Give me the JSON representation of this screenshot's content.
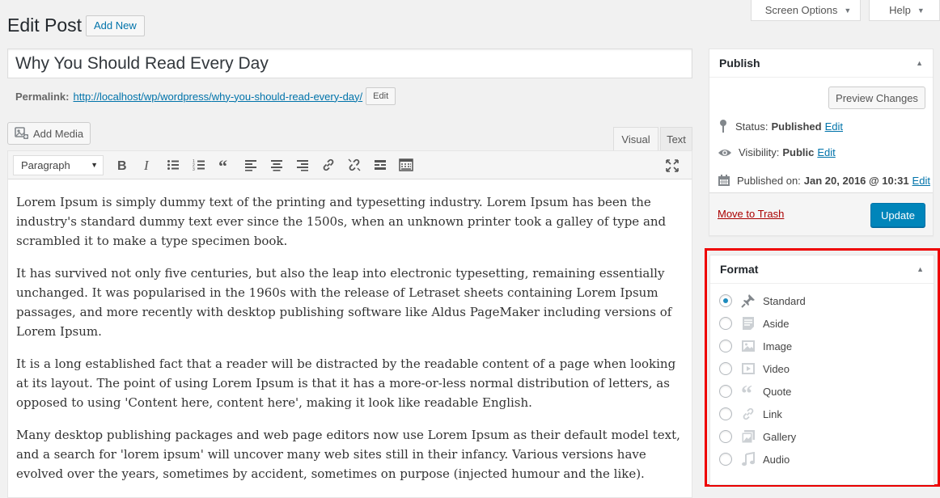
{
  "header": {
    "title": "Edit Post",
    "add_new": "Add New",
    "screen_options": "Screen Options",
    "help": "Help"
  },
  "post": {
    "title_value": "Why You Should Read Every Day",
    "permalink_label": "Permalink:",
    "permalink_base": "http://localhost/wp/wordpress/",
    "permalink_slug": "why-you-should-read-every-day",
    "permalink_end": "/",
    "permalink_edit": "Edit"
  },
  "editor": {
    "add_media": "Add Media",
    "tab_visual": "Visual",
    "tab_text": "Text",
    "format_select": "Paragraph",
    "paragraphs": [
      "Lorem Ipsum is simply dummy text of the printing and typesetting industry. Lorem Ipsum has been the industry's standard dummy text ever since the 1500s, when an unknown printer took a galley of type and scrambled it to make a type specimen book.",
      "It has survived not only five centuries, but also the leap into electronic typesetting, remaining essentially unchanged. It was popularised in the 1960s with the release of Letraset sheets containing Lorem Ipsum passages, and more recently with desktop publishing software like Aldus PageMaker including versions of Lorem Ipsum.",
      "It is a long established fact that a reader will be distracted by the readable content of a page when looking at its layout. The point of using Lorem Ipsum is that it has a more-or-less normal distribution of letters, as opposed to using 'Content here, content here', making it look like readable English.",
      "Many desktop publishing packages and web page editors now use Lorem Ipsum as their default model text, and a search for 'lorem ipsum' will uncover many web sites still in their infancy. Various versions have evolved over the years, sometimes by accident, sometimes on purpose (injected humour and the like)."
    ]
  },
  "publish": {
    "title": "Publish",
    "preview": "Preview Changes",
    "status_label": "Status:",
    "status_value": "Published",
    "visibility_label": "Visibility:",
    "visibility_value": "Public",
    "published_label": "Published on:",
    "published_value": "Jan 20, 2016 @ 10:31",
    "edit": "Edit",
    "trash": "Move to Trash",
    "update": "Update"
  },
  "format": {
    "title": "Format",
    "options": [
      {
        "label": "Standard",
        "icon": "pin-icon",
        "checked": true
      },
      {
        "label": "Aside",
        "icon": "aside-icon",
        "checked": false
      },
      {
        "label": "Image",
        "icon": "image-icon",
        "checked": false
      },
      {
        "label": "Video",
        "icon": "video-icon",
        "checked": false
      },
      {
        "label": "Quote",
        "icon": "quote-icon",
        "checked": false
      },
      {
        "label": "Link",
        "icon": "link-icon",
        "checked": false
      },
      {
        "label": "Gallery",
        "icon": "gallery-icon",
        "checked": false
      },
      {
        "label": "Audio",
        "icon": "audio-icon",
        "checked": false
      }
    ]
  },
  "colors": {
    "primary_button": "#0085ba",
    "link": "#0073aa",
    "highlight_outline": "#ee0000",
    "trash": "#aa0000"
  }
}
